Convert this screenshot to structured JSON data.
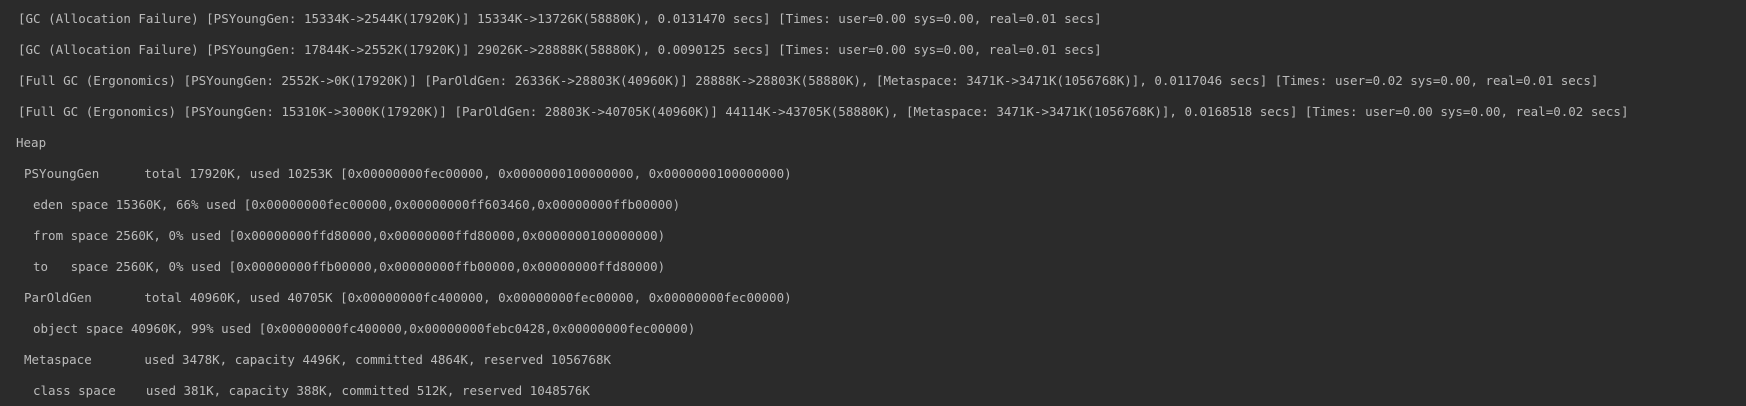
{
  "console": {
    "lines": [
      "[GC (Allocation Failure) [PSYoungGen: 15334K->2544K(17920K)] 15334K->13726K(58880K), 0.0131470 secs] [Times: user=0.00 sys=0.00, real=0.01 secs]",
      "[GC (Allocation Failure) [PSYoungGen: 17844K->2552K(17920K)] 29026K->28888K(58880K), 0.0090125 secs] [Times: user=0.00 sys=0.00, real=0.01 secs]",
      "[Full GC (Ergonomics) [PSYoungGen: 2552K->0K(17920K)] [ParOldGen: 26336K->28803K(40960K)] 28888K->28803K(58880K), [Metaspace: 3471K->3471K(1056768K)], 0.0117046 secs] [Times: user=0.02 sys=0.00, real=0.01 secs]",
      "[Full GC (Ergonomics) [PSYoungGen: 15310K->3000K(17920K)] [ParOldGen: 28803K->40705K(40960K)] 44114K->43705K(58880K), [Metaspace: 3471K->3471K(1056768K)], 0.0168518 secs] [Times: user=0.00 sys=0.00, real=0.02 secs]",
      "Heap",
      "PSYoungGen      total 17920K, used 10253K [0x00000000fec00000, 0x0000000100000000, 0x0000000100000000)",
      "eden space 15360K, 66% used [0x00000000fec00000,0x00000000ff603460,0x00000000ffb00000)",
      "from space 2560K, 0% used [0x00000000ffd80000,0x00000000ffd80000,0x0000000100000000)",
      "to   space 2560K, 0% used [0x00000000ffb00000,0x00000000ffb00000,0x00000000ffd80000)",
      "ParOldGen       total 40960K, used 40705K [0x00000000fc400000, 0x00000000fec00000, 0x00000000fec00000)",
      "object space 40960K, 99% used [0x00000000fc400000,0x00000000febc0428,0x00000000fec00000)",
      "Metaspace       used 3478K, capacity 4496K, committed 4864K, reserved 1056768K",
      "class space    used 381K, capacity 388K, committed 512K, reserved 1048576K"
    ]
  },
  "colors": {
    "background": "#2b2b2b",
    "text": "#bbbbbb"
  }
}
